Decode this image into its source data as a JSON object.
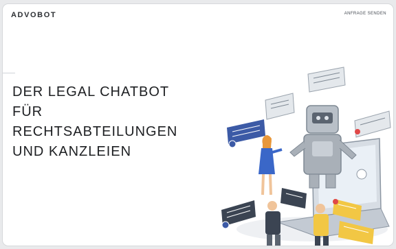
{
  "header": {
    "logo": "ADVOBOT",
    "cta_label": "ANFRAGE SENDEN"
  },
  "hero": {
    "headline_lines": [
      "DER LEGAL CHATBOT",
      "FÜR",
      "RECHTSABTEILUNGEN",
      "UND KANZLEIEN"
    ]
  },
  "colors": {
    "text_dark": "#1d1f22",
    "robot_grey": "#a9b0b8",
    "bubble_dark": "#3b4452",
    "bubble_blue": "#3c5aa6",
    "woman_blue": "#3a67c8",
    "accent_yellow": "#f2c744",
    "accent_red": "#e04848"
  },
  "illustration": {
    "icons": [
      "robot-icon",
      "laptop-icon",
      "chat-bubble-icon",
      "woman-figure-icon",
      "man-figure-icon"
    ]
  }
}
